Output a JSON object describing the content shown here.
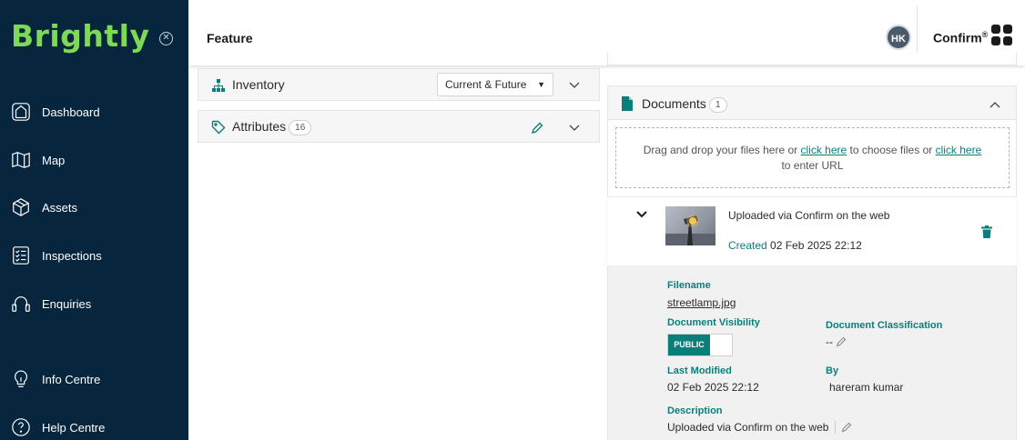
{
  "brand": {
    "logo_text": "Brightly",
    "accent": "#7ed957",
    "sidebar_bg": "#07263d",
    "teal": "#0a7f7a"
  },
  "sidebar": {
    "close_icon": "circle-x-icon",
    "items": [
      {
        "label": "Dashboard",
        "icon": "home-icon"
      },
      {
        "label": "Map",
        "icon": "map-icon"
      },
      {
        "label": "Assets",
        "icon": "cube-icon"
      },
      {
        "label": "Inspections",
        "icon": "checklist-icon"
      },
      {
        "label": "Enquiries",
        "icon": "headset-icon"
      },
      {
        "label": "Info Centre",
        "icon": "bulb-icon"
      },
      {
        "label": "Help Centre",
        "icon": "question-icon"
      }
    ]
  },
  "header": {
    "title": "Feature",
    "avatar_initials": "HK",
    "product": "Confirm",
    "product_mark": "®"
  },
  "left": {
    "inventory": {
      "label": "Inventory",
      "select_value": "Current & Future"
    },
    "attributes": {
      "label": "Attributes",
      "count": "16"
    }
  },
  "documents": {
    "title": "Documents",
    "count": "1",
    "dropzone": {
      "text1": "Drag and drop your files here or ",
      "link1": "click here",
      "text2": " to choose files or ",
      "link2": "click here",
      "text3": "to enter URL"
    },
    "file": {
      "description": "Uploaded via Confirm on the web",
      "created_label": "Created",
      "created_value": "02 Feb 2025 22:12"
    },
    "details": {
      "filename_label": "Filename",
      "filename_value": "streetlamp.jpg",
      "visibility_label": "Document Visibility",
      "visibility_value": "PUBLIC",
      "classification_label": "Document Classification",
      "classification_value": "--",
      "modified_label": "Last Modified",
      "modified_value": "02 Feb 2025 22:12",
      "by_label": "By",
      "by_value": "hareram kumar",
      "description_label": "Description",
      "description_value": "Uploaded via Confirm on the web"
    }
  }
}
